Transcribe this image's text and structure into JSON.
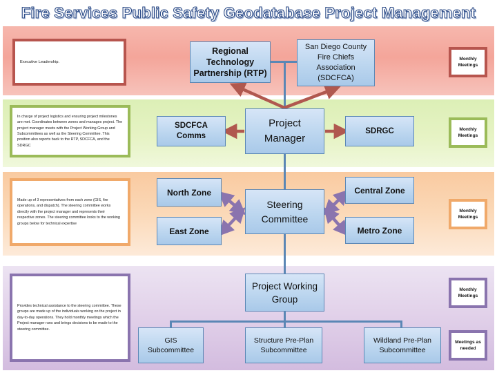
{
  "title": "Fire Services Public Safety Geodatabase Project Management",
  "colors": {
    "band_executive": "#f4a59a",
    "band_manager": "#dcefb6",
    "band_steering": "#f9caa0",
    "band_working": "#d3bcdf",
    "node_fill": "#bcd6ef",
    "node_border": "#5b87b5",
    "connector": "#5b87b5",
    "arrow_red": "#b0584f",
    "arrow_purple": "#8a74ae",
    "title_outline": "#2b4a86"
  },
  "rows": [
    {
      "id": "executive",
      "note": "Executive Leadership.",
      "meeting": "Monthly Meetings"
    },
    {
      "id": "project-manager",
      "note": "In charge of project logistics and ensuring project milestones are met. Coordinates between zones and manages project. The project manager meets with the Project Working Group and Subcommittees as well as the Steering Committee. This position also reports back to the RTP, SDCFCA, and the SDRGC",
      "meeting": "Monthly Meetings"
    },
    {
      "id": "steering",
      "note": "Made up of 3 representatives from each zone (GIS, fire operations, and dispatch). The steering committee works directly with the project manager and represents their respective zones. The steering committee looks to the working groups below for technical expertise",
      "meeting": "Monthly Meetings"
    },
    {
      "id": "working-group",
      "note": "Provides technical assistance to the steering committee. These groups are made up of the individuals working on the project in day-to-day operations. They hold monthly meetings which the Project manager runs and brings decisions to be made to the steering committee.",
      "meeting": "Monthly Meetings",
      "meeting_secondary": "Meetings as needed"
    }
  ],
  "nodes": {
    "rtp": "Regional Technology Partnership (RTP)",
    "sdcfca": "San Diego County Fire Chiefs Association (SDCFCA)",
    "sdcfca_comms": "SDCFCA Comms",
    "project_manager": "Project Manager",
    "sdrgc": "SDRGC",
    "north_zone": "North Zone",
    "east_zone": "East Zone",
    "steering_committee": "Steering Committee",
    "central_zone": "Central Zone",
    "metro_zone": "Metro Zone",
    "project_working_group": "Project Working Group",
    "gis_subcommittee": "GIS Subcommittee",
    "structure_preplan_subcommittee": "Structure Pre-Plan Subcommittee",
    "wildland_preplan_subcommittee": "Wildland Pre-Plan Subcommittee"
  }
}
